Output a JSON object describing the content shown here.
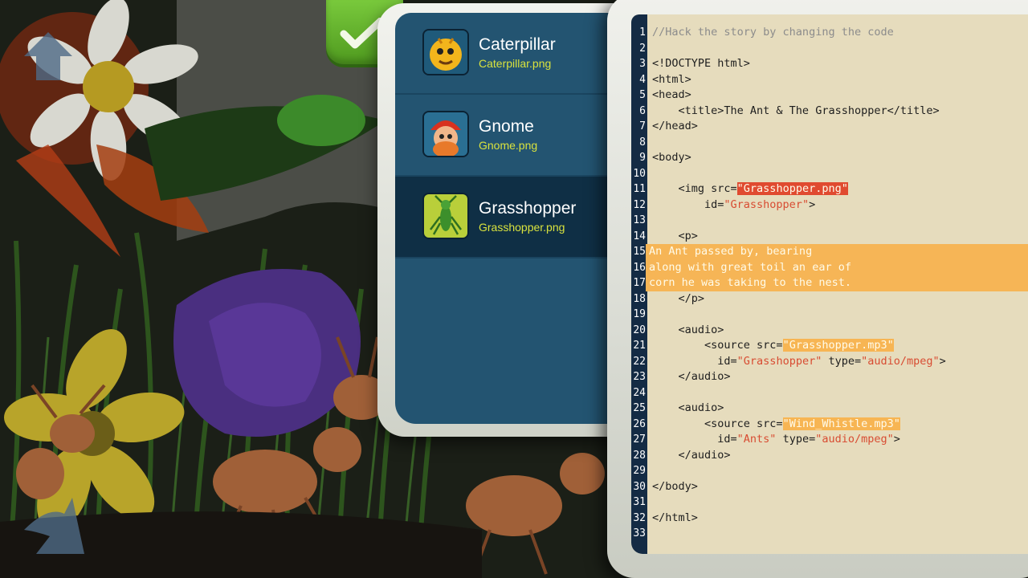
{
  "app": {
    "check_button_icon": "checkmark-icon"
  },
  "file_list": {
    "items": [
      {
        "name": "Caterpillar",
        "file": "Caterpillar.png",
        "icon": "caterpillar-thumbnail",
        "selected": false
      },
      {
        "name": "Gnome",
        "file": "Gnome.png",
        "icon": "gnome-thumbnail",
        "selected": false
      },
      {
        "name": "Grasshopper",
        "file": "Grasshopper.png",
        "icon": "grasshopper-thumbnail",
        "selected": true
      }
    ]
  },
  "editor": {
    "colors": {
      "background": "#e6dcbd",
      "gutter": "#142b44",
      "highlight": "#f6b556",
      "error_highlight": "#e04a30",
      "string": "#d84c32"
    },
    "lines": [
      {
        "num": "1",
        "text": "//Hack the story by changing the code"
      },
      {
        "num": "2",
        "text": ""
      },
      {
        "num": "3",
        "text": "<!DOCTYPE html>"
      },
      {
        "num": "4",
        "text": "<html>"
      },
      {
        "num": "5",
        "text": "<head>"
      },
      {
        "num": "6",
        "text": "    <title>The Ant & The Grasshopper</title>"
      },
      {
        "num": "7",
        "text": "</head>"
      },
      {
        "num": "8",
        "text": ""
      },
      {
        "num": "9",
        "text": "<body>"
      },
      {
        "num": "10",
        "text": ""
      },
      {
        "num": "11",
        "pre": "    <img src=",
        "val": "\"Grasshopper.png\"",
        "post": ""
      },
      {
        "num": "12",
        "pre": "        id=",
        "val": "\"Grasshopper\"",
        "post": ">"
      },
      {
        "num": "13",
        "text": ""
      },
      {
        "num": "14",
        "text": "    <p>"
      },
      {
        "num": "15",
        "text": "An Ant passed by, bearing"
      },
      {
        "num": "16",
        "text": "along with great toil an ear of"
      },
      {
        "num": "17",
        "text": "corn he was taking to the nest."
      },
      {
        "num": "18",
        "text": "    </p>"
      },
      {
        "num": "19",
        "text": ""
      },
      {
        "num": "20",
        "text": "    <audio>"
      },
      {
        "num": "21",
        "pre": "        <source src=",
        "val": "\"Grasshopper.mp3\"",
        "post": ""
      },
      {
        "num": "22",
        "pre": "          id=",
        "val": "\"Grasshopper\"",
        "mid": " type=",
        "val2": "\"audio/mpeg\"",
        "post": ">"
      },
      {
        "num": "23",
        "text": "    </audio>"
      },
      {
        "num": "24",
        "text": ""
      },
      {
        "num": "25",
        "text": "    <audio>"
      },
      {
        "num": "26",
        "pre": "        <source src=",
        "val": "\"Wind_Whistle.mp3\"",
        "post": ""
      },
      {
        "num": "27",
        "pre": "          id=",
        "val": "\"Ants\"",
        "mid": " type=",
        "val2": "\"audio/mpeg\"",
        "post": ">"
      },
      {
        "num": "28",
        "text": "    </audio>"
      },
      {
        "num": "29",
        "text": ""
      },
      {
        "num": "30",
        "text": "</body>"
      },
      {
        "num": "31",
        "text": ""
      },
      {
        "num": "32",
        "text": "</html>"
      },
      {
        "num": "33",
        "text": ""
      }
    ]
  }
}
